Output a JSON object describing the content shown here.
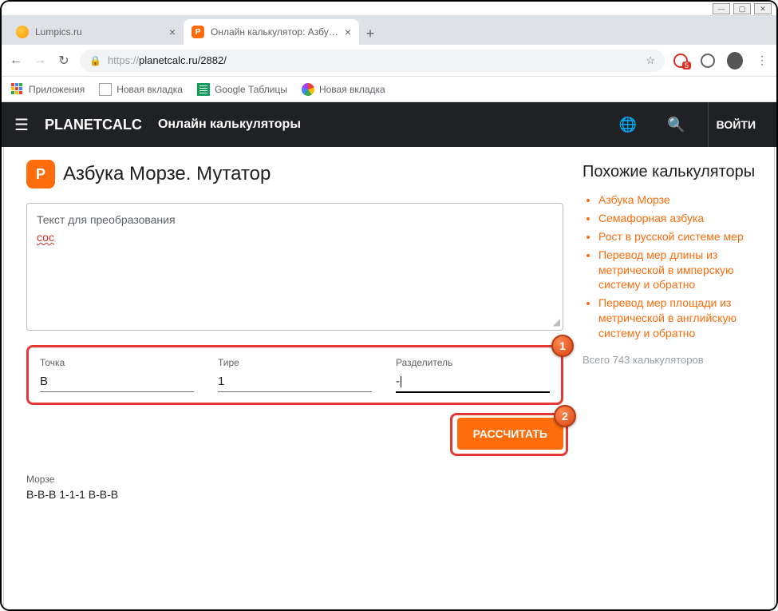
{
  "window": {
    "min": "—",
    "max": "▢",
    "close": "✕"
  },
  "tabs": [
    {
      "title": "Lumpics.ru",
      "active": false
    },
    {
      "title": "Онлайн калькулятор: Азбука М…",
      "active": true
    }
  ],
  "nav": {
    "back": "←",
    "forward": "→",
    "reload": "↻"
  },
  "url": {
    "proto": "https://",
    "host_path": "planetcalc.ru/2882/",
    "adblock_count": "5"
  },
  "bookmarks": [
    {
      "label": "Приложения"
    },
    {
      "label": "Новая вкладка"
    },
    {
      "label": "Google Таблицы"
    },
    {
      "label": "Новая вкладка"
    }
  ],
  "header": {
    "brand": "PLANETCALC",
    "subtitle": "Онлайн калькуляторы",
    "login": "ВОЙТИ"
  },
  "page": {
    "title": "Азбука Морзе. Мутатор",
    "textarea_label": "Текст для преобразования",
    "textarea_value": "сос",
    "params": {
      "dot": {
        "label": "Точка",
        "value": "В"
      },
      "dash": {
        "label": "Тире",
        "value": "1"
      },
      "sep": {
        "label": "Разделитель",
        "value": "-"
      }
    },
    "calculate": "РАССЧИТАТЬ",
    "result_label": "Морзе",
    "result_value": "B-B-B 1-1-1 B-B-B"
  },
  "sidebar": {
    "title": "Похожие калькуляторы",
    "items": [
      "Азбука Морзе",
      "Семафорная азбука",
      "Рост в русской системе мер",
      "Перевод мер длины из метрической в имперскую систему и обратно",
      "Перевод мер площади из метрической в английскую систему и обратно"
    ],
    "footer": "Всего 743 калькуляторов"
  },
  "badges": {
    "b1": "1",
    "b2": "2"
  }
}
